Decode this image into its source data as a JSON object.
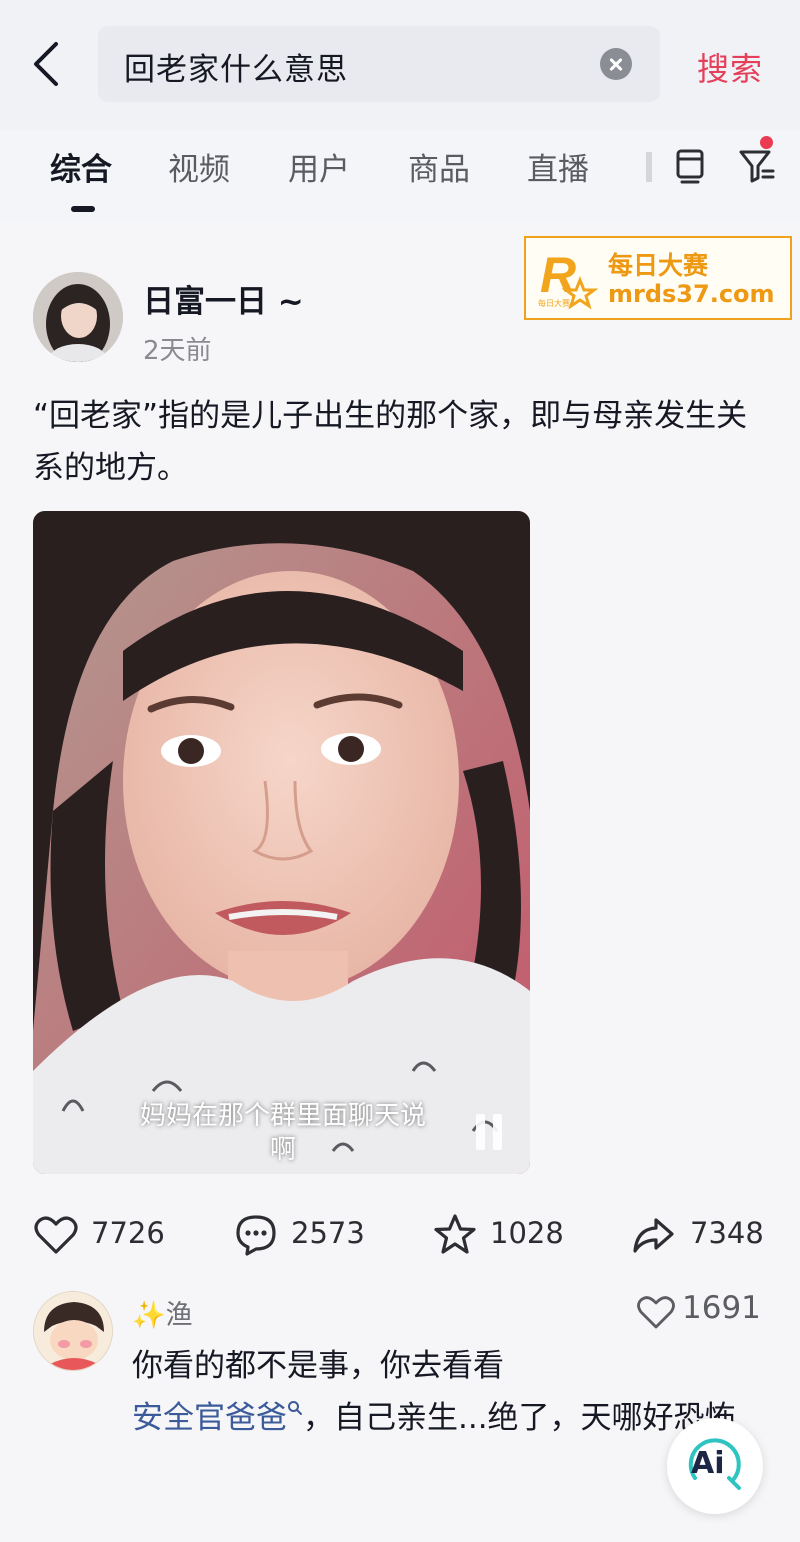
{
  "search": {
    "query": "回老家什么意思",
    "button_label": "搜索"
  },
  "tabs": [
    {
      "label": "综合",
      "active": true
    },
    {
      "label": "视频",
      "active": false
    },
    {
      "label": "用户",
      "active": false
    },
    {
      "label": "商品",
      "active": false
    },
    {
      "label": "直播",
      "active": false
    }
  ],
  "watermark": {
    "title": "每日大赛",
    "url": "mrds37.com",
    "logo_letter": "R",
    "logo_small_text": "每日大赛"
  },
  "post": {
    "author": "日富一日 ~",
    "time": "2天前",
    "text": "“回老家”指的是儿子出生的那个家，即与母亲发生关系的地方。",
    "video_subtitle_line1": "妈妈在那个群里面聊天说",
    "video_subtitle_line2": "啊"
  },
  "actions": {
    "likes": "7726",
    "comments": "2573",
    "favorites": "1028",
    "shares": "7348"
  },
  "comment": {
    "author": "✨渔",
    "likes": "1691",
    "text_line1": "你看的都不是事，你去看看",
    "link_text": "安全官爸爸",
    "text_after_link": "，自己亲生...绝了，天哪好恐怖"
  },
  "ai_button": {
    "label": "Ai"
  },
  "colors": {
    "accent": "#e4405c",
    "watermark": "#ee9913",
    "link": "#3b5b9a"
  },
  "icons": [
    "back-icon",
    "clear-icon",
    "list-icon",
    "filter-icon",
    "heart-icon",
    "comment-icon",
    "star-icon",
    "share-icon",
    "pause-icon",
    "search-icon"
  ]
}
